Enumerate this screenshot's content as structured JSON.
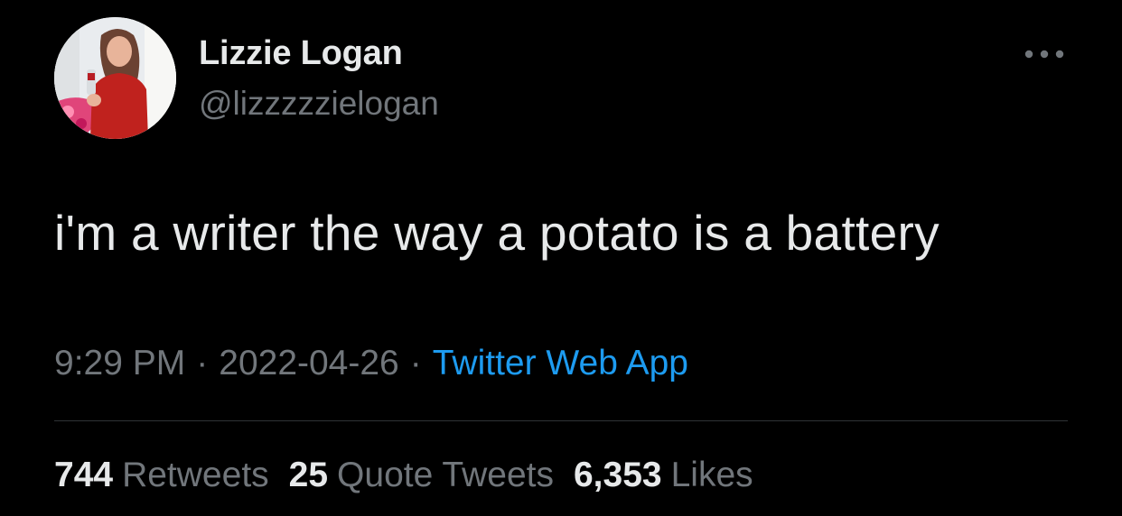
{
  "tweet": {
    "author": {
      "display_name": "Lizzie Logan",
      "handle": "@lizzzzzielogan",
      "avatar": "profile-photo"
    },
    "more_icon": "ellipsis-icon",
    "text": "i'm a writer the way a potato is a battery",
    "time": "9:29 PM",
    "separator": "·",
    "date": "2022-04-26",
    "source": "Twitter Web App",
    "stats": {
      "retweets": {
        "count": "744",
        "label": "Retweets"
      },
      "quote_tweets": {
        "count": "25",
        "label": "Quote Tweets"
      },
      "likes": {
        "count": "6,353",
        "label": "Likes"
      }
    }
  },
  "colors": {
    "background": "#000000",
    "primary_text": "#e7e9ea",
    "secondary_text": "#71767b",
    "link": "#1d9bf0",
    "divider": "#2f3336"
  }
}
